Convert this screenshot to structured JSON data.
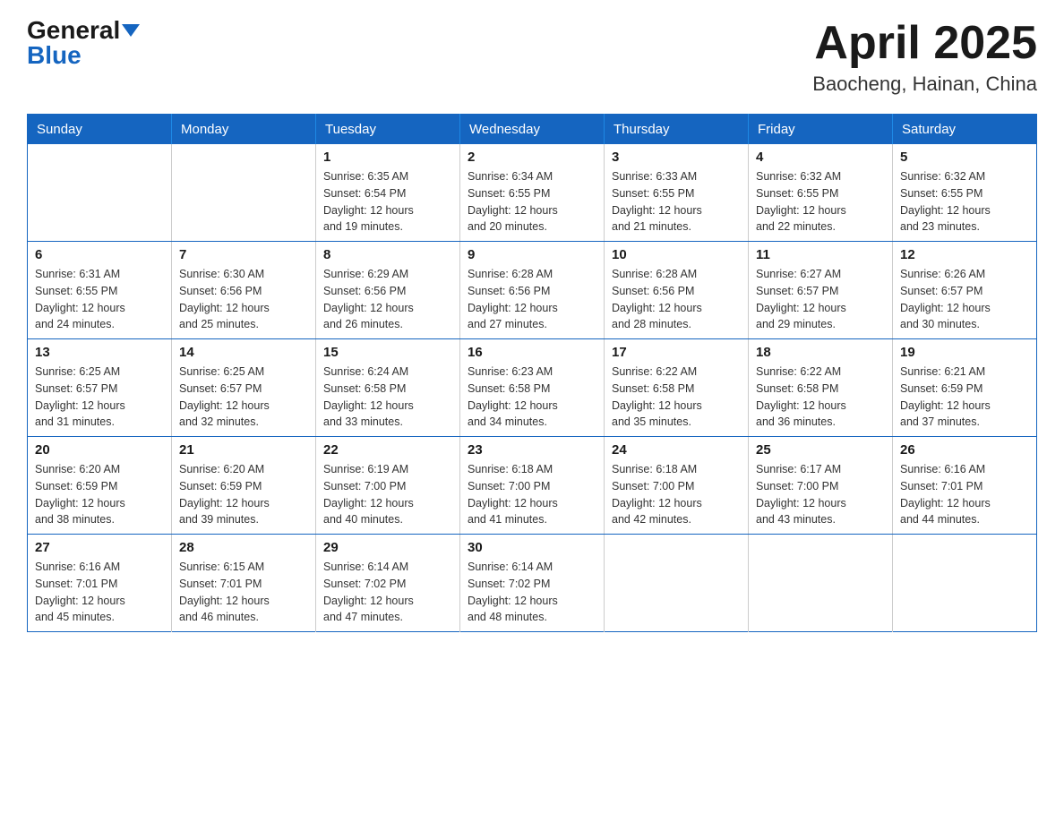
{
  "header": {
    "logo_general": "General",
    "logo_blue": "Blue",
    "title": "April 2025",
    "location": "Baocheng, Hainan, China"
  },
  "calendar": {
    "days_of_week": [
      "Sunday",
      "Monday",
      "Tuesday",
      "Wednesday",
      "Thursday",
      "Friday",
      "Saturday"
    ],
    "weeks": [
      [
        {
          "day": "",
          "info": ""
        },
        {
          "day": "",
          "info": ""
        },
        {
          "day": "1",
          "info": "Sunrise: 6:35 AM\nSunset: 6:54 PM\nDaylight: 12 hours\nand 19 minutes."
        },
        {
          "day": "2",
          "info": "Sunrise: 6:34 AM\nSunset: 6:55 PM\nDaylight: 12 hours\nand 20 minutes."
        },
        {
          "day": "3",
          "info": "Sunrise: 6:33 AM\nSunset: 6:55 PM\nDaylight: 12 hours\nand 21 minutes."
        },
        {
          "day": "4",
          "info": "Sunrise: 6:32 AM\nSunset: 6:55 PM\nDaylight: 12 hours\nand 22 minutes."
        },
        {
          "day": "5",
          "info": "Sunrise: 6:32 AM\nSunset: 6:55 PM\nDaylight: 12 hours\nand 23 minutes."
        }
      ],
      [
        {
          "day": "6",
          "info": "Sunrise: 6:31 AM\nSunset: 6:55 PM\nDaylight: 12 hours\nand 24 minutes."
        },
        {
          "day": "7",
          "info": "Sunrise: 6:30 AM\nSunset: 6:56 PM\nDaylight: 12 hours\nand 25 minutes."
        },
        {
          "day": "8",
          "info": "Sunrise: 6:29 AM\nSunset: 6:56 PM\nDaylight: 12 hours\nand 26 minutes."
        },
        {
          "day": "9",
          "info": "Sunrise: 6:28 AM\nSunset: 6:56 PM\nDaylight: 12 hours\nand 27 minutes."
        },
        {
          "day": "10",
          "info": "Sunrise: 6:28 AM\nSunset: 6:56 PM\nDaylight: 12 hours\nand 28 minutes."
        },
        {
          "day": "11",
          "info": "Sunrise: 6:27 AM\nSunset: 6:57 PM\nDaylight: 12 hours\nand 29 minutes."
        },
        {
          "day": "12",
          "info": "Sunrise: 6:26 AM\nSunset: 6:57 PM\nDaylight: 12 hours\nand 30 minutes."
        }
      ],
      [
        {
          "day": "13",
          "info": "Sunrise: 6:25 AM\nSunset: 6:57 PM\nDaylight: 12 hours\nand 31 minutes."
        },
        {
          "day": "14",
          "info": "Sunrise: 6:25 AM\nSunset: 6:57 PM\nDaylight: 12 hours\nand 32 minutes."
        },
        {
          "day": "15",
          "info": "Sunrise: 6:24 AM\nSunset: 6:58 PM\nDaylight: 12 hours\nand 33 minutes."
        },
        {
          "day": "16",
          "info": "Sunrise: 6:23 AM\nSunset: 6:58 PM\nDaylight: 12 hours\nand 34 minutes."
        },
        {
          "day": "17",
          "info": "Sunrise: 6:22 AM\nSunset: 6:58 PM\nDaylight: 12 hours\nand 35 minutes."
        },
        {
          "day": "18",
          "info": "Sunrise: 6:22 AM\nSunset: 6:58 PM\nDaylight: 12 hours\nand 36 minutes."
        },
        {
          "day": "19",
          "info": "Sunrise: 6:21 AM\nSunset: 6:59 PM\nDaylight: 12 hours\nand 37 minutes."
        }
      ],
      [
        {
          "day": "20",
          "info": "Sunrise: 6:20 AM\nSunset: 6:59 PM\nDaylight: 12 hours\nand 38 minutes."
        },
        {
          "day": "21",
          "info": "Sunrise: 6:20 AM\nSunset: 6:59 PM\nDaylight: 12 hours\nand 39 minutes."
        },
        {
          "day": "22",
          "info": "Sunrise: 6:19 AM\nSunset: 7:00 PM\nDaylight: 12 hours\nand 40 minutes."
        },
        {
          "day": "23",
          "info": "Sunrise: 6:18 AM\nSunset: 7:00 PM\nDaylight: 12 hours\nand 41 minutes."
        },
        {
          "day": "24",
          "info": "Sunrise: 6:18 AM\nSunset: 7:00 PM\nDaylight: 12 hours\nand 42 minutes."
        },
        {
          "day": "25",
          "info": "Sunrise: 6:17 AM\nSunset: 7:00 PM\nDaylight: 12 hours\nand 43 minutes."
        },
        {
          "day": "26",
          "info": "Sunrise: 6:16 AM\nSunset: 7:01 PM\nDaylight: 12 hours\nand 44 minutes."
        }
      ],
      [
        {
          "day": "27",
          "info": "Sunrise: 6:16 AM\nSunset: 7:01 PM\nDaylight: 12 hours\nand 45 minutes."
        },
        {
          "day": "28",
          "info": "Sunrise: 6:15 AM\nSunset: 7:01 PM\nDaylight: 12 hours\nand 46 minutes."
        },
        {
          "day": "29",
          "info": "Sunrise: 6:14 AM\nSunset: 7:02 PM\nDaylight: 12 hours\nand 47 minutes."
        },
        {
          "day": "30",
          "info": "Sunrise: 6:14 AM\nSunset: 7:02 PM\nDaylight: 12 hours\nand 48 minutes."
        },
        {
          "day": "",
          "info": ""
        },
        {
          "day": "",
          "info": ""
        },
        {
          "day": "",
          "info": ""
        }
      ]
    ]
  }
}
